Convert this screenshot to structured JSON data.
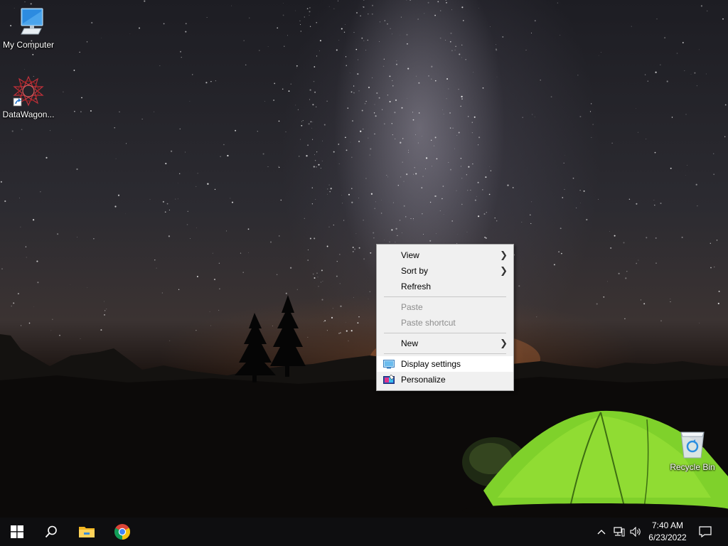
{
  "desktop": {
    "icons": [
      {
        "label": "My Computer",
        "icon": "computer-icon"
      },
      {
        "label": "DataWagon...",
        "icon": "datawagon-shortcut-icon"
      },
      {
        "label": "Recycle Bin",
        "icon": "recycle-bin-icon"
      }
    ]
  },
  "context_menu": {
    "items": [
      {
        "label": "View",
        "submenu": true,
        "enabled": true
      },
      {
        "label": "Sort by",
        "submenu": true,
        "enabled": true
      },
      {
        "label": "Refresh",
        "enabled": true
      },
      {
        "label": "Paste",
        "enabled": false
      },
      {
        "label": "Paste shortcut",
        "enabled": false
      },
      {
        "label": "New",
        "submenu": true,
        "enabled": true
      },
      {
        "label": "Display settings",
        "icon": "display-icon",
        "enabled": true,
        "highlighted": true
      },
      {
        "label": "Personalize",
        "icon": "personalize-icon",
        "enabled": true
      }
    ]
  },
  "taskbar": {
    "buttons": [
      {
        "icon": "windows-start-icon"
      },
      {
        "icon": "search-icon"
      },
      {
        "icon": "file-explorer-icon"
      },
      {
        "icon": "chrome-icon"
      }
    ],
    "tray": {
      "icons": [
        "chevron-up-icon",
        "network-icon",
        "volume-icon",
        "notification-icon"
      ]
    },
    "clock": {
      "time": "7:40 AM",
      "date": "6/23/2022"
    }
  }
}
